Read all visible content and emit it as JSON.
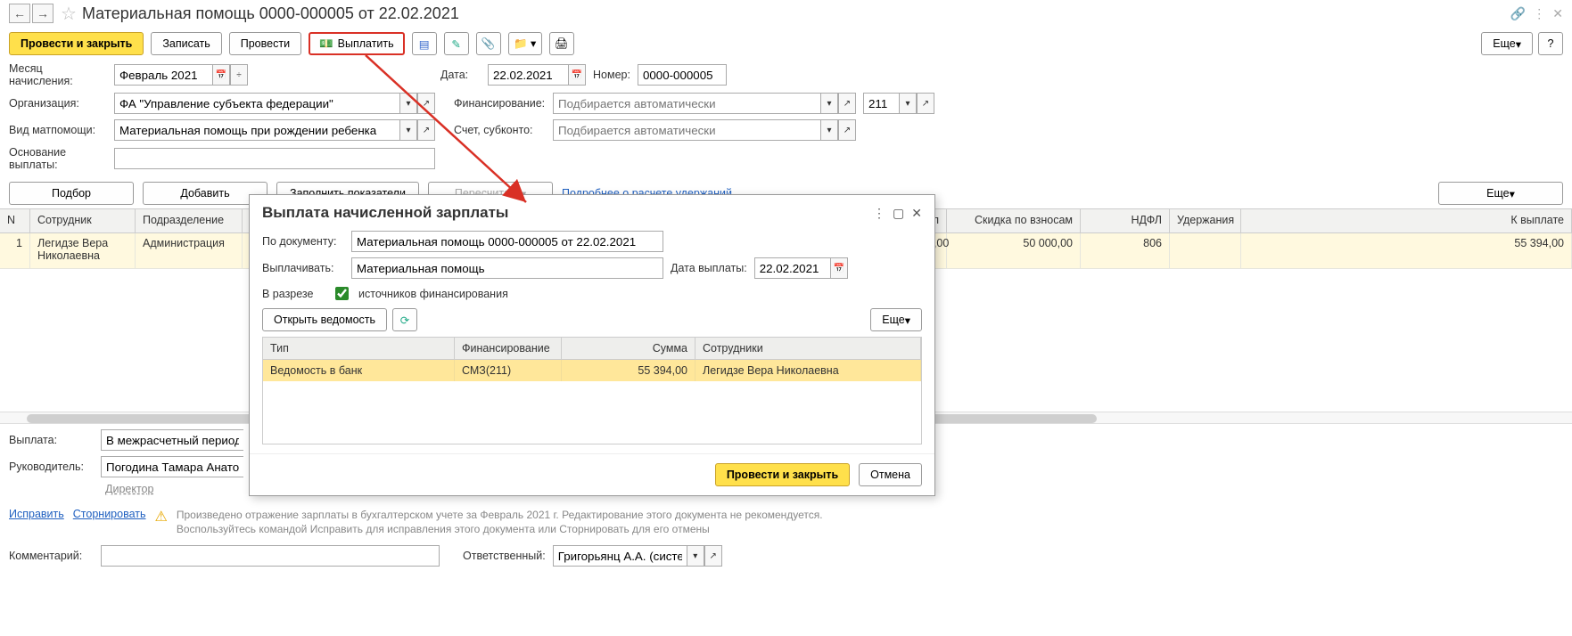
{
  "title": "Материальная помощь 0000-000005 от 22.02.2021",
  "toolbar": {
    "post_close": "Провести и закрыть",
    "save": "Записать",
    "post": "Провести",
    "pay": "Выплатить",
    "more": "Еще",
    "help": "?"
  },
  "form": {
    "month_label": "Месяц начисления:",
    "month_value": "Февраль 2021",
    "date_label": "Дата:",
    "date_value": "22.02.2021",
    "number_label": "Номер:",
    "number_value": "0000-000005",
    "org_label": "Организация:",
    "org_value": "ФА \"Управление субъекта федерации\"",
    "fin_label": "Финансирование:",
    "fin_placeholder": "Подбирается автоматически",
    "code_value": "211",
    "type_label": "Вид матпомощи:",
    "type_value": "Материальная помощь при рождении ребенка",
    "acct_label": "Счет, субконто:",
    "acct_placeholder": "Подбирается автоматически",
    "basis_label": "Основание выплаты:"
  },
  "actions": {
    "select": "Подбор",
    "add": "Добавить",
    "fill": "Заполнить показатели",
    "recalc": "Пересчитать",
    "details_link": "Подробнее о расчете удержаний...",
    "more": "Еще"
  },
  "table": {
    "headers": {
      "n": "N",
      "employee": "Сотрудник",
      "department": "Подразделение",
      "hidden_col": "л",
      "discount": "Скидка по взносам",
      "ndfl": "НДФЛ",
      "deductions": "Удержания",
      "payout": "К выплате"
    },
    "rows": [
      {
        "n": "1",
        "employee": "Легидзе Вера Николаевна",
        "department": "Администрация",
        "sum_partial": "0,00",
        "discount": "50 000,00",
        "ndfl": "806",
        "deductions": "",
        "payout": "55 394,00"
      }
    ]
  },
  "footer": {
    "payout_label": "Выплата:",
    "payout_value": "В межрасчетный период",
    "manager_label": "Руководитель:",
    "manager_value": "Погодина Тамара Анатолье",
    "director": "Директор",
    "fix": "Исправить",
    "storno": "Сторнировать",
    "warn": "Произведено отражение зарплаты в бухгалтерском учете за Февраль 2021 г. Редактирование этого документа не рекомендуется. Воспользуйтесь командой Исправить для исправления этого документа или Сторнировать для его отмены",
    "comment_label": "Комментарий:",
    "resp_label": "Ответственный:",
    "resp_value": "Григорьянц А.А. (системн"
  },
  "popup": {
    "title": "Выплата начисленной зарплаты",
    "doc_label": "По документу:",
    "doc_value": "Материальная помощь 0000-000005 от 22.02.2021",
    "pay_label": "Выплачивать:",
    "pay_value": "Материальная помощь",
    "date_label": "Дата выплаты:",
    "date_value": "22.02.2021",
    "breakdown_label": "В разрезе",
    "breakdown_chk": "источников финансирования",
    "open_vedomost": "Открыть ведомость",
    "more": "Еще",
    "headers": {
      "type": "Тип",
      "fin": "Финансирование",
      "sum": "Сумма",
      "emp": "Сотрудники"
    },
    "row": {
      "type": "Ведомость в банк",
      "fin": "СМЗ(211)",
      "sum": "55 394,00",
      "emp": "Легидзе Вера Николаевна"
    },
    "post_close": "Провести и закрыть",
    "cancel": "Отмена"
  }
}
